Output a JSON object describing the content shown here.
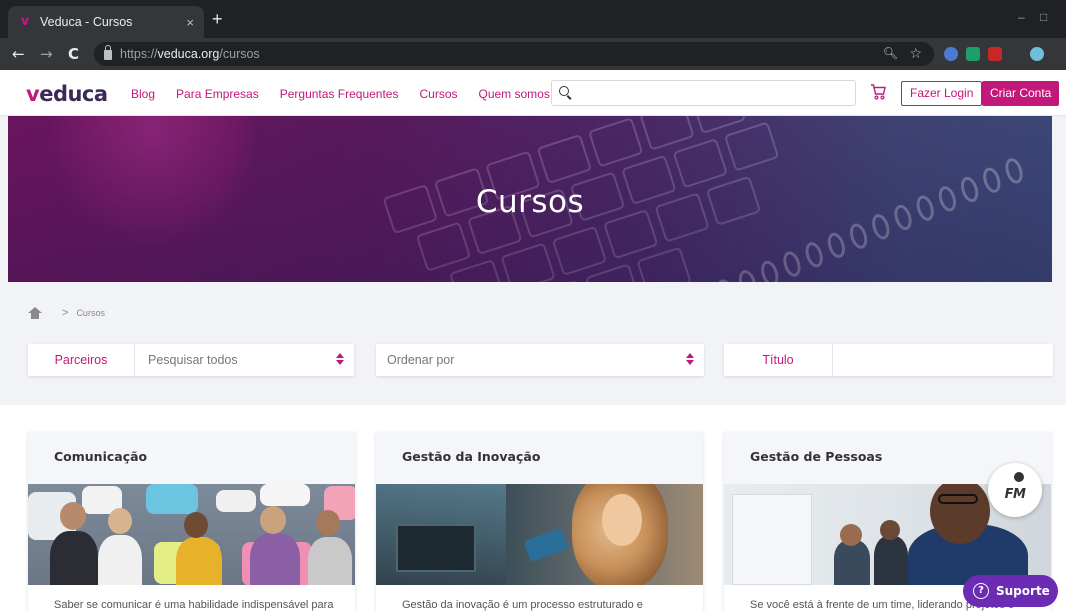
{
  "browser": {
    "tab_title": "Veduca - Cursos",
    "tab_favicon": "v",
    "tab_close": "×",
    "new_tab": "+",
    "url_scheme": "https://",
    "url_host": "veduca.org",
    "url_path": "/cursos",
    "back_icon": "←",
    "forward_icon": "→",
    "reload_icon": "C"
  },
  "header": {
    "logo_v": "v",
    "logo_rest": "educa",
    "nav": [
      {
        "label": "Blog"
      },
      {
        "label": "Para Empresas"
      },
      {
        "label": "Perguntas Frequentes"
      },
      {
        "label": "Cursos"
      },
      {
        "label": "Quem somos"
      }
    ],
    "search_value": "",
    "login_label": "Fazer Login",
    "signup_label": "Criar Conta"
  },
  "hero": {
    "title": "Cursos"
  },
  "breadcrumb": {
    "separator": ">",
    "current": "Cursos"
  },
  "filters": {
    "partners_label": "Parceiros",
    "partners_value": "Pesquisar todos",
    "sort_placeholder": "Ordenar por",
    "title_label": "Título",
    "title_value": ""
  },
  "courses": [
    {
      "title": "Comunicação",
      "description": "Saber se comunicar é uma habilidade indispensável para"
    },
    {
      "title": "Gestão da Inovação",
      "description": "Gestão da inovação é um processo estruturado e"
    },
    {
      "title": "Gestão de Pessoas",
      "description": "Se você está à frente de um time, liderando projetos e"
    }
  ],
  "support": {
    "label": "Suporte",
    "icon": "?"
  },
  "colors": {
    "brand": "#c2187a",
    "support": "#6b2bb3"
  }
}
